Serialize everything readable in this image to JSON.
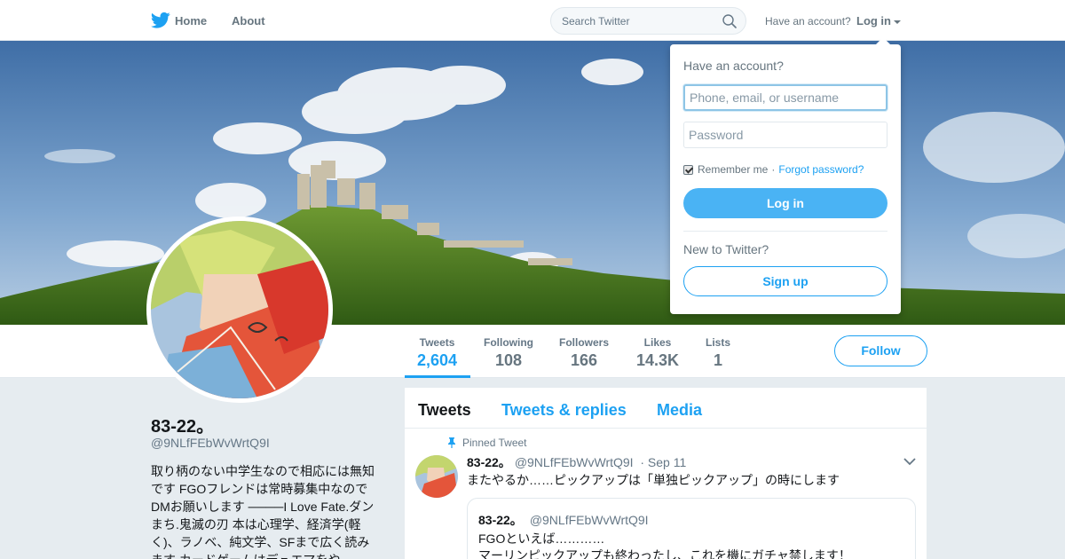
{
  "nav": {
    "home": "Home",
    "about": "About",
    "search_placeholder": "Search Twitter",
    "have_account": "Have an account?",
    "login": "Log in"
  },
  "profile_nav": {
    "stats": [
      {
        "label": "Tweets",
        "value": "2,604"
      },
      {
        "label": "Following",
        "value": "108"
      },
      {
        "label": "Followers",
        "value": "166"
      },
      {
        "label": "Likes",
        "value": "14.3K"
      },
      {
        "label": "Lists",
        "value": "1"
      }
    ],
    "follow": "Follow"
  },
  "profile": {
    "name": "83-22。",
    "handle": "@9NLfFEbWvWrtQ9I",
    "bio": "取り柄のない中学生なので相応には無知です FGOフレンドは常時募集中なのでDMお願いします ────I Love Fate.ダンまち.鬼滅の刃 本は心理学、経済学(軽く)、ラノベ、純文学、SFまで広く読みます カードゲームはデュエマをや"
  },
  "timeline": {
    "tabs": [
      "Tweets",
      "Tweets & replies",
      "Media"
    ],
    "pinned_label": "Pinned Tweet",
    "tweet": {
      "name": "83-22。",
      "handle": "@9NLfFEbWvWrtQ9I",
      "date": "Sep 11",
      "text": "またやるか……ピックアップは「単独ピックアップ」の時にします",
      "quote": {
        "name": "83-22。",
        "handle": "@9NLfFEbWvWrtQ9I",
        "line1": "FGOといえば…………",
        "line2": "マーリンピックアップも終わったし、これを機にガチャ禁します！"
      }
    }
  },
  "login_dropdown": {
    "title": "Have an account?",
    "username_placeholder": "Phone, email, or username",
    "password_placeholder": "Password",
    "remember": "Remember me",
    "separator": "·",
    "forgot": "Forgot password?",
    "login_button": "Log in",
    "new_to": "New to Twitter?",
    "signup_button": "Sign up"
  },
  "colors": {
    "accent": "#1da1f2",
    "login_button": "#4ab3f4",
    "muted_text": "#657786",
    "page_bg": "#e6ecf0"
  },
  "icons": [
    "twitter-bird-icon",
    "search-icon",
    "chevron-down-icon",
    "pin-icon",
    "checkbox-icon"
  ]
}
